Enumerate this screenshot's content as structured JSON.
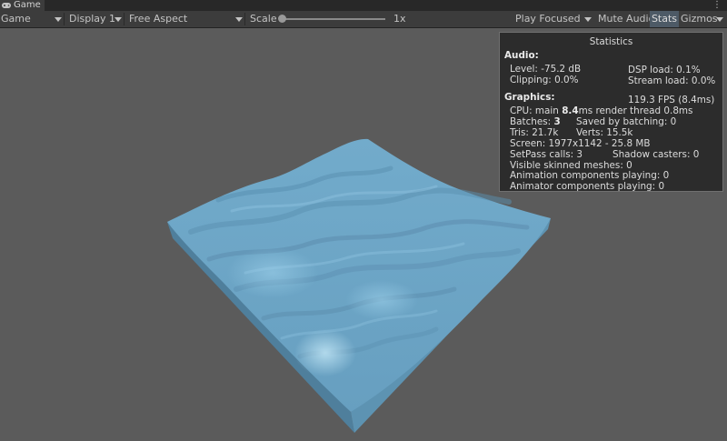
{
  "window": {
    "tab_title": "Game",
    "more_menu": "⋮"
  },
  "toolbar": {
    "mode": "Game",
    "display": "Display 1",
    "aspect": "Free Aspect",
    "scale_label": "Scale",
    "scale_value": "1x",
    "play_mode": "Play Focused",
    "mute_audio": "Mute Audio",
    "stats": "Stats",
    "gizmos": "Gizmos"
  },
  "stats_panel": {
    "title": "Statistics",
    "audio_header": "Audio:",
    "level": "Level: -75.2 dB",
    "dsp_load": "DSP load: 0.1%",
    "clipping": "Clipping: 0.0%",
    "stream_load": "Stream load: 0.0%",
    "graphics_header": "Graphics:",
    "fps": "119.3 FPS (8.4ms)",
    "cpu_prefix": "CPU: main ",
    "cpu_main": "8.4",
    "cpu_mid": "ms  render thread 0.8ms",
    "batches_prefix": "Batches: ",
    "batches_value": "3",
    "saved_by_batching": "Saved by batching: 0",
    "tris": "Tris: 21.7k",
    "verts": "Verts: 15.5k",
    "screen": "Screen: 1977x1142 - 25.8 MB",
    "setpass": "SetPass calls: 3",
    "shadow_casters": "Shadow casters: 0",
    "skinned_meshes": "Visible skinned meshes: 0",
    "animation_components": "Animation components playing: 0",
    "animator_components": "Animator components playing: 0"
  },
  "colors": {
    "viewport_bg": "#5b5b5b",
    "water_top": "#6aa7c9",
    "water_side": "#5b8fad",
    "toolbar": "#3c3c3c"
  },
  "icons": {
    "tab": "gamepad-icon"
  }
}
